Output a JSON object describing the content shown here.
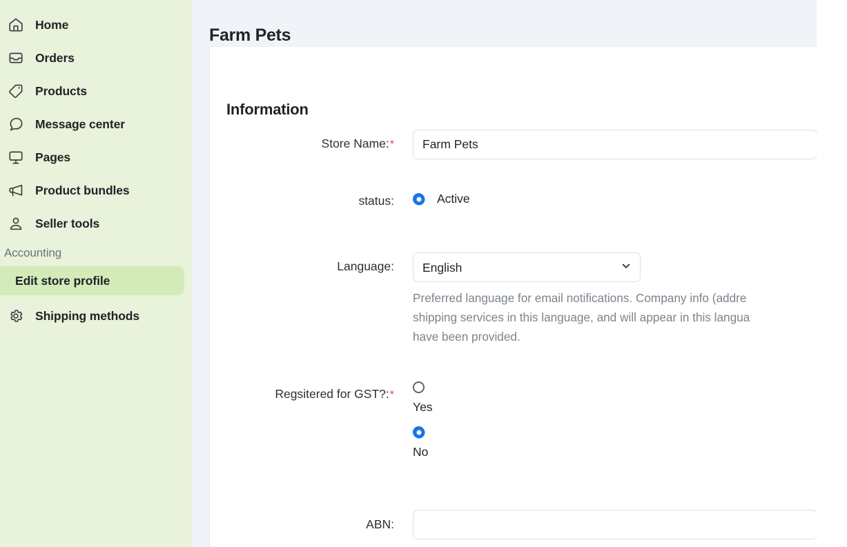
{
  "sidebar": {
    "items": [
      {
        "label": "Home",
        "icon": "home-icon",
        "type": "link"
      },
      {
        "label": "Orders",
        "icon": "inbox-icon",
        "type": "link"
      },
      {
        "label": "Products",
        "icon": "tag-icon",
        "type": "link"
      },
      {
        "label": "Message center",
        "icon": "chat-bubble-icon",
        "type": "link"
      },
      {
        "label": "Pages",
        "icon": "monitor-icon",
        "type": "link"
      },
      {
        "label": "Product bundles",
        "icon": "megaphone-icon",
        "type": "link"
      },
      {
        "label": "Seller tools",
        "icon": "user-icon",
        "type": "link"
      },
      {
        "label": "Accounting",
        "icon": "",
        "type": "section"
      },
      {
        "label": "Edit store profile",
        "icon": "",
        "type": "link",
        "active": true
      },
      {
        "label": "Shipping methods",
        "icon": "gear-icon",
        "type": "link"
      }
    ],
    "background_color": "#e9f2da",
    "active_color": "#d3ebb8"
  },
  "header": {
    "title": "Farm Pets"
  },
  "form": {
    "section_title": "Information",
    "store_name": {
      "label": "Store Name:",
      "required": true,
      "value": "Farm Pets",
      "placeholder": ""
    },
    "status": {
      "label": "status:",
      "required": false,
      "options": [
        {
          "label": "Active",
          "checked": true
        }
      ]
    },
    "language": {
      "label": "Language:",
      "required": false,
      "value": "English",
      "options": [
        "English"
      ],
      "help_text": "Preferred language for email notifications. Company info (addre\nshipping services in this language, and will appear in this langua\nhave been provided."
    },
    "gst": {
      "label": "Regsitered for GST?:",
      "required": true,
      "options": [
        {
          "label": "Yes",
          "checked": false
        },
        {
          "label": "No",
          "checked": true
        }
      ]
    },
    "abn": {
      "label": "ABN:",
      "required": false,
      "value": "",
      "placeholder": ""
    }
  },
  "colors": {
    "accent_blue": "#1a73e8",
    "required_red": "#e0465e",
    "page_background": "#f0f3f8",
    "text_primary": "#1f2328",
    "text_muted": "#7c848d"
  }
}
